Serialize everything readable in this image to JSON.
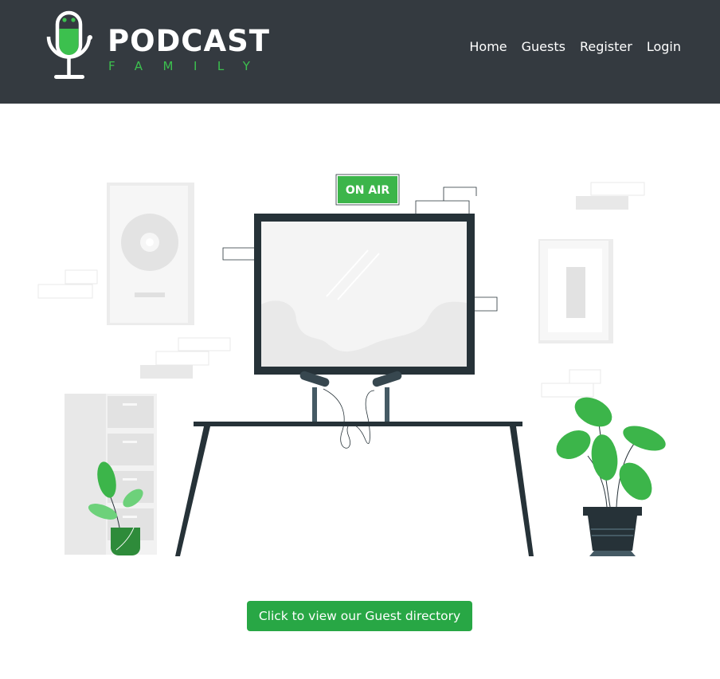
{
  "brand": {
    "name": "PODCAST",
    "sub": "FAMILY"
  },
  "nav": {
    "items": [
      {
        "label": "Home"
      },
      {
        "label": "Guests"
      },
      {
        "label": "Register"
      },
      {
        "label": "Login"
      }
    ]
  },
  "hero": {
    "sign_text": "ON AIR"
  },
  "cta": {
    "label": "Click to view our Guest directory"
  },
  "colors": {
    "navbar": "#343a40",
    "accent": "#28a745",
    "brand_green": "#3cc04e",
    "dark": "#263238"
  }
}
